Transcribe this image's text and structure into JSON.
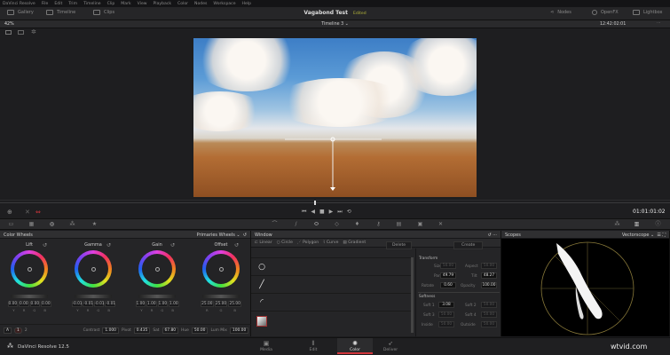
{
  "menu": [
    "DaVinci Resolve",
    "File",
    "Edit",
    "Trim",
    "Timeline",
    "Clip",
    "Mark",
    "View",
    "Playback",
    "Color",
    "Nodes",
    "Workspace",
    "Help"
  ],
  "toolbar": {
    "gallery": "Gallery",
    "timeline": "Timeline",
    "clips": "Clips",
    "project_title": "Vagabond Test",
    "status": "Edited",
    "nodes": "Nodes",
    "openfx": "OpenFX",
    "lightbox": "Lightbox"
  },
  "viewer": {
    "zoom": "42%",
    "timeline_name": "Timeline 3",
    "timecode": "12:42:02:01",
    "playhead_timecode": "01:01:01:02"
  },
  "color_wheels": {
    "title": "Color Wheels",
    "mode": "Primaries Wheels",
    "wheels": [
      {
        "label": "Lift",
        "values": [
          "0.00",
          "0.00",
          "0.00",
          "0.00"
        ],
        "channels": [
          "Y",
          "R",
          "G",
          "B"
        ]
      },
      {
        "label": "Gamma",
        "values": [
          "-0.01",
          "-0.01",
          "-0.01",
          "-0.01"
        ],
        "channels": [
          "Y",
          "R",
          "G",
          "B"
        ]
      },
      {
        "label": "Gain",
        "values": [
          "1.00",
          "1.00",
          "1.00",
          "1.00"
        ],
        "channels": [
          "Y",
          "R",
          "G",
          "B"
        ]
      },
      {
        "label": "Offset",
        "values": [
          "25.00",
          "25.00",
          "25.00"
        ],
        "channels": [
          "R",
          "G",
          "B"
        ]
      }
    ],
    "a_button": "A",
    "page1": "1",
    "page2": "2",
    "contrast_label": "Contrast",
    "contrast": "1.000",
    "pivot_label": "Pivot",
    "pivot": "0.435",
    "sat_label": "Sat",
    "sat": "67.80",
    "hue_label": "Hue",
    "hue": "50.00",
    "lummix_label": "Lum Mix",
    "lummix": "100.00"
  },
  "window": {
    "title": "Window",
    "tools": [
      "Linear",
      "Circle",
      "Polygon",
      "Curve",
      "Gradient"
    ],
    "delete": "Delete",
    "create": "Create",
    "transform_title": "Transform",
    "size_label": "Size",
    "size": "50.00",
    "aspect_label": "Aspect",
    "aspect": "50.00",
    "pan_label": "Pan",
    "pan": "49.79",
    "tilt_label": "Tilt",
    "tilt": "48.27",
    "rotate_label": "Rotate",
    "rotate": "0.60",
    "opacity_label": "Opacity",
    "opacity": "100.00",
    "softness_title": "Softness",
    "soft1_label": "Soft 1",
    "soft1": "3.08",
    "soft2_label": "Soft 2",
    "soft2": "50.00",
    "soft3_label": "Soft 3",
    "soft3": "50.00",
    "soft4_label": "Soft 4",
    "soft4": "50.00",
    "inside_label": "Inside",
    "inside": "50.00",
    "outside_label": "Outside",
    "outside": "50.00"
  },
  "scopes": {
    "title": "Scopes",
    "mode": "Vectorscope"
  },
  "footer": {
    "app": "DaVinci Resolve 12.5",
    "pages": [
      "Media",
      "Edit",
      "Color",
      "Deliver"
    ],
    "active_page": "Color",
    "watermark": "wtvid.com"
  },
  "colors": {
    "accent_red": "#d0353b",
    "edited": "#b5b53a"
  }
}
